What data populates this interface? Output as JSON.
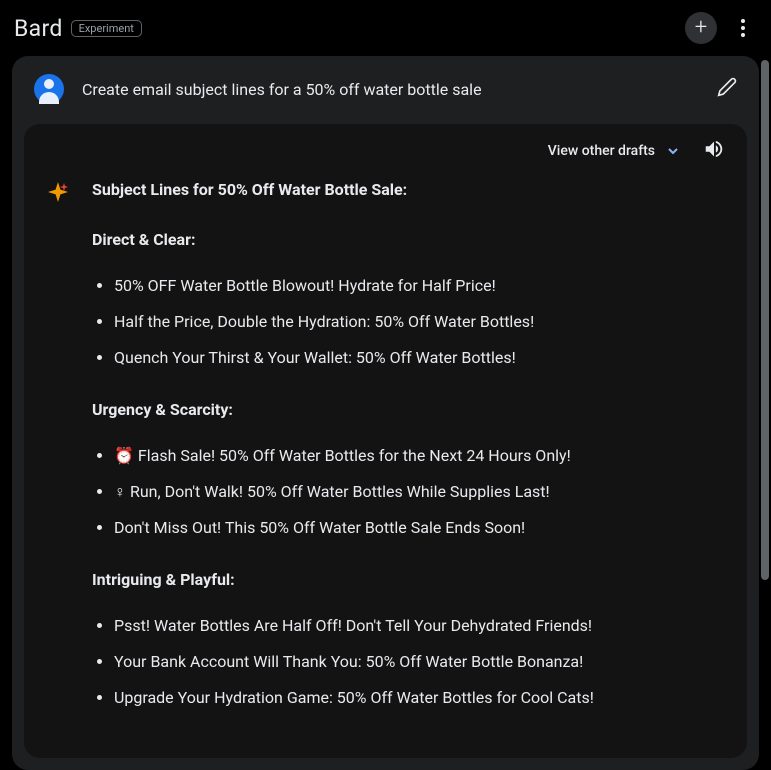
{
  "header": {
    "brand": "Bard",
    "badge": "Experiment"
  },
  "prompt": {
    "text": "Create email subject lines for a 50% off water bottle sale"
  },
  "response": {
    "drafts_label": "View other drafts",
    "title": "Subject Lines for 50% Off Water Bottle Sale:",
    "sections": [
      {
        "heading": "Direct & Clear:",
        "items": [
          "50% OFF Water Bottle Blowout! Hydrate for Half Price!",
          "Half the Price, Double the Hydration: 50% Off Water Bottles!",
          "Quench Your Thirst & Your Wallet: 50% Off Water Bottles!"
        ]
      },
      {
        "heading": "Urgency & Scarcity:",
        "items": [
          "⏰ Flash Sale! 50% Off Water Bottles for the Next 24 Hours Only!",
          "♀ Run, Don't Walk! 50% Off Water Bottles While Supplies Last!",
          "Don't Miss Out! This 50% Off Water Bottle Sale Ends Soon!"
        ]
      },
      {
        "heading": "Intriguing & Playful:",
        "items": [
          "Psst! Water Bottles Are Half Off! Don't Tell Your Dehydrated Friends!",
          "Your Bank Account Will Thank You: 50% Off Water Bottle Bonanza!",
          "Upgrade Your Hydration Game: 50% Off Water Bottles for Cool Cats!"
        ]
      }
    ]
  }
}
